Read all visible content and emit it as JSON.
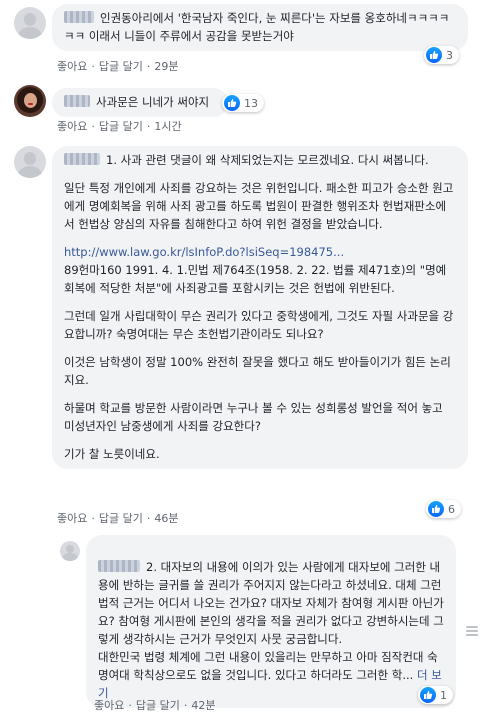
{
  "comments": [
    {
      "text": "인권동아리에서 '한국남자 죽인다, 눈 찌른다'는 자보를 옹호하네ㅋㅋㅋㅋㅋㅋ 이래서 니들이 주류에서 공감을 못받는거야",
      "like": "좋아요",
      "reply": "답글 달기",
      "time": "29분",
      "reactions": "3"
    },
    {
      "text": "사과문은 니네가 써야지",
      "like": "좋아요",
      "reply": "답글 달기",
      "time": "1시간",
      "reactions": "13"
    },
    {
      "paragraphs": [
        "1. 사과 관련 댓글이 왜 삭제되었는지는 모르겠네요. 다시 써봅니다.",
        "일단 특정 개인에게 사죄를 강요하는 것은 위헌입니다. 패소한 피고가 승소한 원고에게 명예회복을 위해 사죄 광고를 하도록 법원이 판결한 행위조차 헌법재판소에서 헌법상 양심의 자유를 침해한다고 하여 위헌 결정을 받았습니다.",
        "그런데 일개 사립대학이 무슨 권리가 있다고 중학생에게, 그것도 자필 사과문을 강요합니까? 숙명여대는 무슨 초헌법기관이라도 되나요?",
        "이것은 남학생이 정말 100% 완전히 잘못을 했다고 해도 받아들이기가 힘든 논리지요.",
        "하물며 학교를 방문한 사람이라면 누구나 볼 수 있는 성희롱성 발언을 적어 놓고 미성년자인 남중생에게 사죄를 강요한다?",
        "기가 찰 노릇이네요."
      ],
      "link": "http://www.law.go.kr/lsInfoP.do?lsiSeq=198475...",
      "citation": "89헌마160 1991. 4. 1.민법 제764조(1958. 2. 22. 법률 제471호)의 \"명예회복에 적당한 처분\"에 사죄광고를 포함시키는 것은 헌법에 위반된다.",
      "like": "좋아요",
      "reply": "답글 달기",
      "time": "46분",
      "reactions": "6"
    },
    {
      "text": "2. 대자보의 내용에 이의가 있는 사람에게 대자보에 그러한 내용에 반하는 글귀를 쓸 권리가 주어지지 않는다라고 하셨네요. 대체 그런 법적 근거는 어디서 나오는 건가요? 대자보 자체가 참여형 게시판 아닌가요? 참여형 게시판에 본인의 생각을 적을 권리가 없다고 강변하시는데 그렇게 생각하시는 근거가 무엇인지 사뭇 궁금합니다.\n대한민국 법령 체계에 그런 내용이 있을리는 만무하고 아마 짐작컨대 숙명여대 학칙상으로도 없을 것입니다. 있다고 하더라도 그러한 학...",
      "see_more": "더 보기",
      "like": "좋아요",
      "reply": "답글 달기",
      "time": "42분",
      "reactions": "1"
    }
  ],
  "colors": {
    "bubble": "#f2f3f5",
    "link": "#385898",
    "meta": "#606770",
    "like_blue": "#0866ff"
  },
  "icons": [
    "avatar-icon",
    "like-icon",
    "comment-options-icon"
  ]
}
